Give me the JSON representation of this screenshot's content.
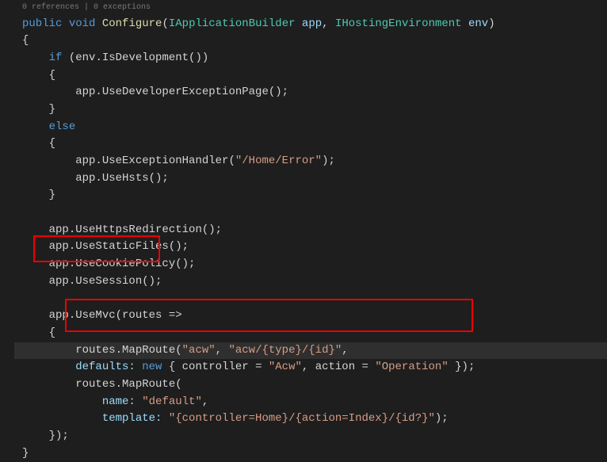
{
  "codelens": "0 references | 0 exceptions",
  "code": {
    "kw_public": "public",
    "kw_void": "void",
    "method_configure": "Configure",
    "type_iappbuilder": "IApplicationBuilder",
    "param_app": "app",
    "type_ihostenv": "IHostingEnvironment",
    "param_env": "env",
    "brace_open": "{",
    "kw_if": "if",
    "env_isdev_call": "env.IsDevelopment()",
    "app_devex": "app.UseDeveloperExceptionPage();",
    "brace_close": "}",
    "kw_else": "else",
    "app_useexh": "app.UseExceptionHandler(",
    "str_homeerror": "\"/Home/Error\"",
    "close_paren_semi": ");",
    "app_usehsts": "app.UseHsts();",
    "app_https": "app.UseHttpsRedirection();",
    "app_static": "app.UseStaticFiles();",
    "app_cookie": "app.UseCookiePolicy();",
    "app_session": "app.UseSession();",
    "app_usemvc": "app.UseMvc(routes =>",
    "routes_maproute": "routes.MapRoute(",
    "str_acw": "\"acw\"",
    "comma": ", ",
    "str_acw_route": "\"acw/{type}/{id}\"",
    "comma_only": ",",
    "defaults_label": "defaults: ",
    "kw_new": "new",
    "anon_open": " { controller = ",
    "str_Acw": "\"Acw\"",
    "action_eq": ", action = ",
    "str_Operation": "\"Operation\"",
    "anon_close": " });",
    "name_label": "name: ",
    "str_default": "\"default\"",
    "template_label": "template: ",
    "str_template": "\"{controller=Home}/{action=Index}/{id?}\"",
    "close_brace_paren": "});"
  }
}
